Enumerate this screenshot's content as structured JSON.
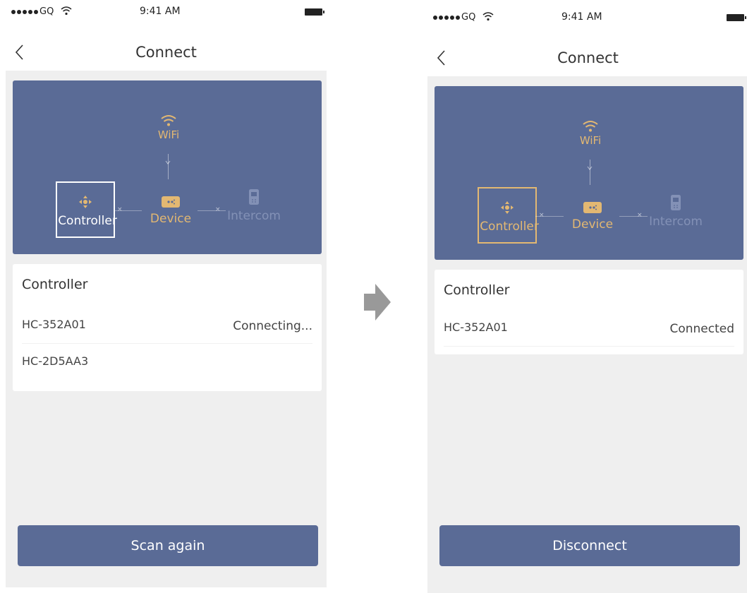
{
  "status_bar": {
    "carrier": "GQ",
    "time": "9:41 AM"
  },
  "screens": [
    {
      "nav": {
        "title": "Connect"
      },
      "diagram": {
        "wifi": "WiFi",
        "controller": "Controller",
        "device": "Device",
        "intercom": "Intercom"
      },
      "list": {
        "title": "Controller",
        "devices": [
          {
            "name": "HC-352A01",
            "status": "Connecting..."
          },
          {
            "name": "HC-2D5AA3",
            "status": ""
          }
        ]
      },
      "button": "Scan again"
    },
    {
      "nav": {
        "title": "Connect"
      },
      "diagram": {
        "wifi": "WiFi",
        "controller": "Controller",
        "device": "Device",
        "intercom": "Intercom"
      },
      "list": {
        "title": "Controller",
        "devices": [
          {
            "name": "HC-352A01",
            "status": "Connected"
          }
        ]
      },
      "button": "Disconnect"
    }
  ],
  "colors": {
    "primary": "#5a6b96",
    "accent": "#e3b872",
    "background": "#efefef",
    "intercom_dim": "#8391b6"
  },
  "icons": {
    "back": "chevron-left-icon",
    "wifi": "wifi-icon",
    "controller": "gamepad-icon",
    "device": "device-icon",
    "intercom": "intercom-icon",
    "transition": "arrow-right-icon"
  }
}
